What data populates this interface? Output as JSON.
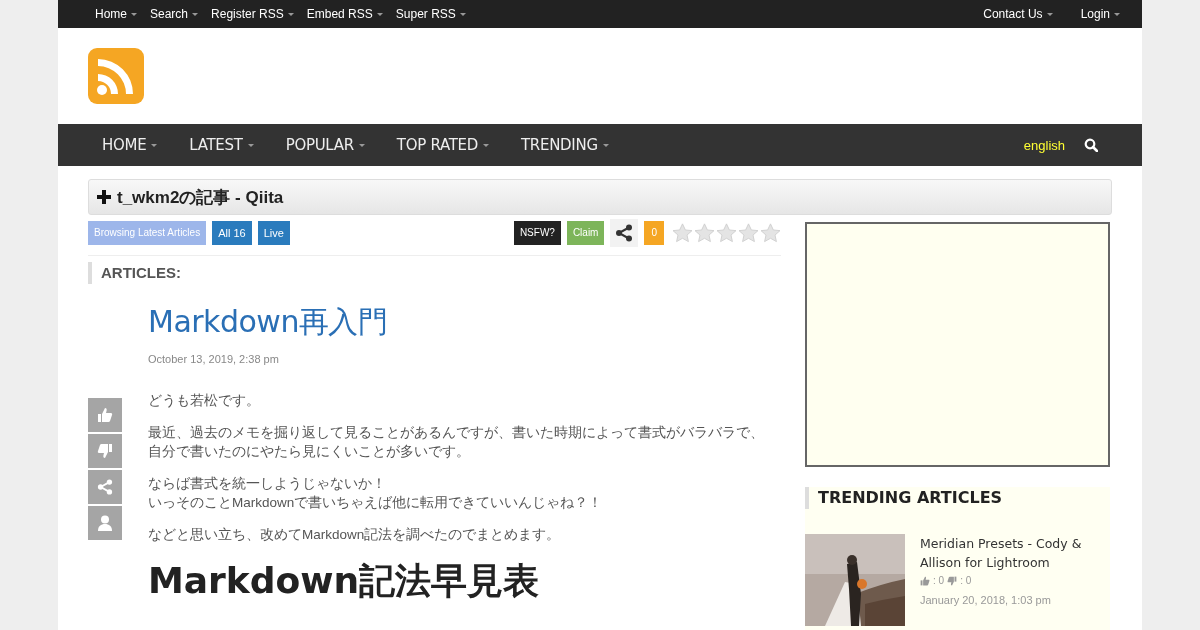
{
  "top_menu": {
    "left": [
      "Home",
      "Search",
      "Register RSS",
      "Embed RSS",
      "Super RSS"
    ],
    "right": [
      "Contact Us",
      "Login"
    ]
  },
  "main_nav": {
    "items": [
      "HOME",
      "LATEST",
      "POPULAR",
      "TOP RATED",
      "TRENDING"
    ],
    "language": "english"
  },
  "feed": {
    "title": "t_wkm2の記事 - Qiita",
    "toolbar": {
      "browsing": "Browsing Latest Articles",
      "all": "All 16",
      "live": "Live",
      "nsfw": "NSFW?",
      "claim": "Claim",
      "count": "0",
      "stars": 0
    }
  },
  "articles_heading": "ARTICLES:",
  "article": {
    "title": "Markdown再入門",
    "date": "October 13, 2019, 2:38 pm",
    "paragraphs": [
      [
        "どうも若松です。"
      ],
      [
        "最近、過去のメモを掘り返して見ることがあるんですが、書いた時期によって書式がバラバラで、",
        "自分で書いたのにやたら見にくいことが多いです。"
      ],
      [
        "ならば書式を統一しようじゃないか！",
        "いっそのことMarkdownで書いちゃえば他に転用できていいんじゃね？！"
      ],
      [
        "などと思い立ち、改めてMarkdown記法を調べたのでまとめます。"
      ]
    ],
    "heading": "Markdown記法早見表"
  },
  "sidebar": {
    "trending_title": "TRENDING ARTICLES",
    "items": [
      {
        "kind": "picture",
        "title": "Meridian Presets - Cody & Allison for Lightroom",
        "likes": ": 0",
        "dislikes": ": 0",
        "date": "January 20, 2018, 1:03 pm"
      }
    ]
  }
}
